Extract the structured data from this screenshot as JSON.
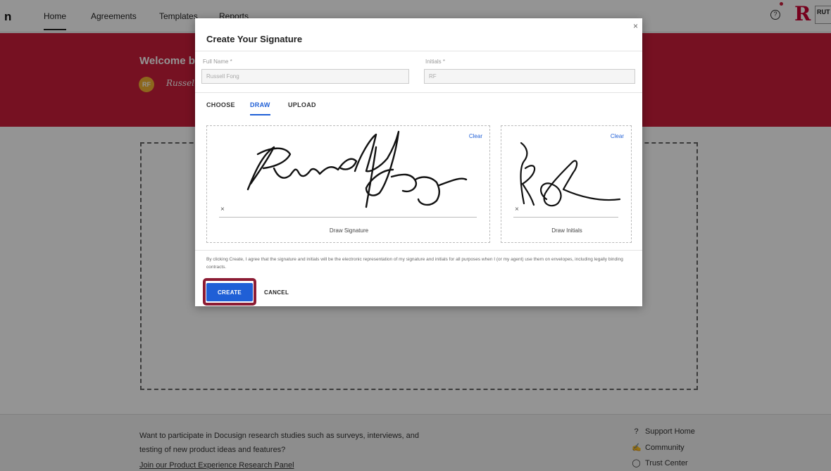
{
  "topnav": {
    "logo_fragment": "n",
    "items": [
      {
        "label": "Home",
        "active": true
      },
      {
        "label": "Agreements",
        "active": false
      },
      {
        "label": "Templates",
        "active": false
      },
      {
        "label": "Reports",
        "active": false
      }
    ],
    "help_icon": "question-circle-icon",
    "brand_letter": "R",
    "brand_text": "RUT"
  },
  "banner": {
    "welcome_fragment": "Welcome ba",
    "avatar_initials": "RF",
    "signature_fragment": "Russel"
  },
  "modal": {
    "title": "Create Your Signature",
    "close_symbol": "×",
    "full_name_label": "Full Name *",
    "full_name_value": "Russell Fong",
    "initials_label": "Initials *",
    "initials_value": "RF",
    "tabs": [
      {
        "label": "CHOOSE",
        "active": false
      },
      {
        "label": "DRAW",
        "active": true
      },
      {
        "label": "UPLOAD",
        "active": false
      }
    ],
    "signature_pad": {
      "clear_label": "Clear",
      "x_marker": "×",
      "caption": "Draw Signature"
    },
    "initials_pad": {
      "clear_label": "Clear",
      "x_marker": "×",
      "caption": "Draw Initials"
    },
    "agreement_text": "By clicking Create, I agree that the signature and initials will be the electronic representation of my signature and initials for all purposes when I (or my agent) use them on envelopes, including legally binding contracts.",
    "create_label": "CREATE",
    "cancel_label": "CANCEL"
  },
  "footer": {
    "research_text": "Want to participate in Docusign research studies such as surveys, interviews, and testing of new product ideas and features?",
    "research_link": "Join our Product Experience Research Panel",
    "links": [
      {
        "icon": "help-circle-icon",
        "label": "Support Home"
      },
      {
        "icon": "chat-bubbles-icon",
        "label": "Community"
      },
      {
        "icon": "shield-icon",
        "label": "Trust Center"
      }
    ]
  },
  "colors": {
    "banner": "#cc1e3c",
    "primary_button": "#1f5fd6",
    "highlight_outline": "#8c1c34",
    "avatar": "#f2b233"
  }
}
